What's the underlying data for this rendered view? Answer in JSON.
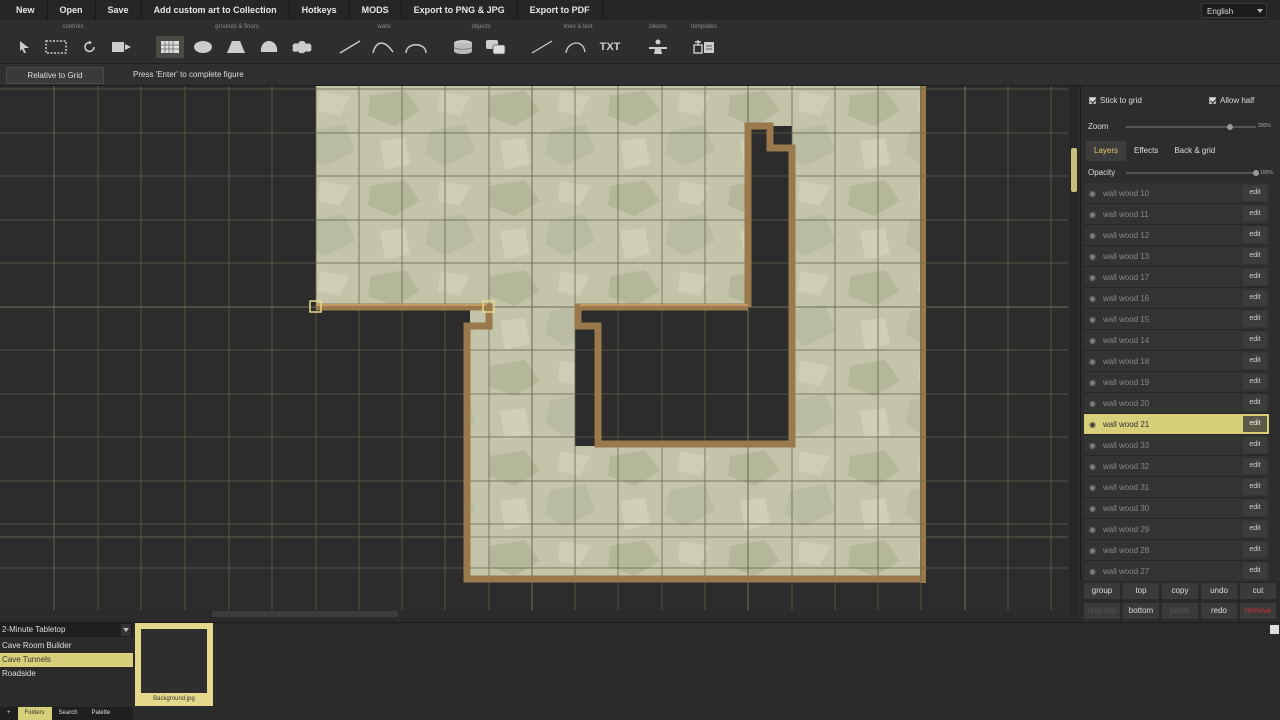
{
  "menu": [
    "New",
    "Open",
    "Save",
    "Add custom art to Collection",
    "Hotkeys",
    "MODS",
    "Export to PNG & JPG",
    "Export to PDF"
  ],
  "language": "English",
  "toolbar": {
    "groups": {
      "controls": "controls",
      "grounds": "grounds & floors",
      "walls": "walls",
      "objects": "objects",
      "lines": "lines & text",
      "tokens": "tokens",
      "templates": "templates"
    },
    "txt_label": "TXT"
  },
  "status": {
    "relative_button": "Relative to Grid",
    "hint": "Press 'Enter' to complete figure"
  },
  "panel": {
    "stick_to_grid": "Stick to grid",
    "allow_half": "Allow half",
    "zoom_label": "Zoom",
    "zoom_value": "200%",
    "zoom_level": 0.8,
    "tabs": [
      "Layers",
      "Effects",
      "Back & grid"
    ],
    "opacity_label": "Opacity",
    "opacity_value": "100%",
    "opacity_level": 1.0,
    "edit_label": "edit",
    "layers": [
      "wall wood 10",
      "wall wood 11",
      "wall wood 12",
      "wall wood 13",
      "wall wood 17",
      "wall wood 16",
      "wall wood 15",
      "wall wood 14",
      "wall wood 18",
      "wall wood 19",
      "wall wood 20",
      "wall wood 21",
      "wall wood 33",
      "wall wood 32",
      "wall wood 31",
      "wall wood 30",
      "wall wood 29",
      "wall wood 28",
      "wall wood 27"
    ],
    "selected_layer": "wall wood 21",
    "actions": {
      "group": "group",
      "top": "top",
      "copy": "copy",
      "undo": "undo",
      "cut": "cut",
      "ungroup": "ungroup",
      "bottom": "bottom",
      "paste": "paste",
      "redo": "redo",
      "remove": "remove"
    }
  },
  "bottom": {
    "collection": "2-Minute Tabletop",
    "folders": [
      "Cave Room Builder",
      "Cave Tunnels",
      "Roadside"
    ],
    "selected_folder": "Cave Tunnels",
    "asset_caption": "Background.jpg",
    "tabs": [
      "+",
      "Folders",
      "Search",
      "Palette"
    ]
  },
  "colors": {
    "accent": "#d7cf7a",
    "floor": "#c4c4a8",
    "wall": "#9a7a4c",
    "grid": "#5f6248"
  }
}
